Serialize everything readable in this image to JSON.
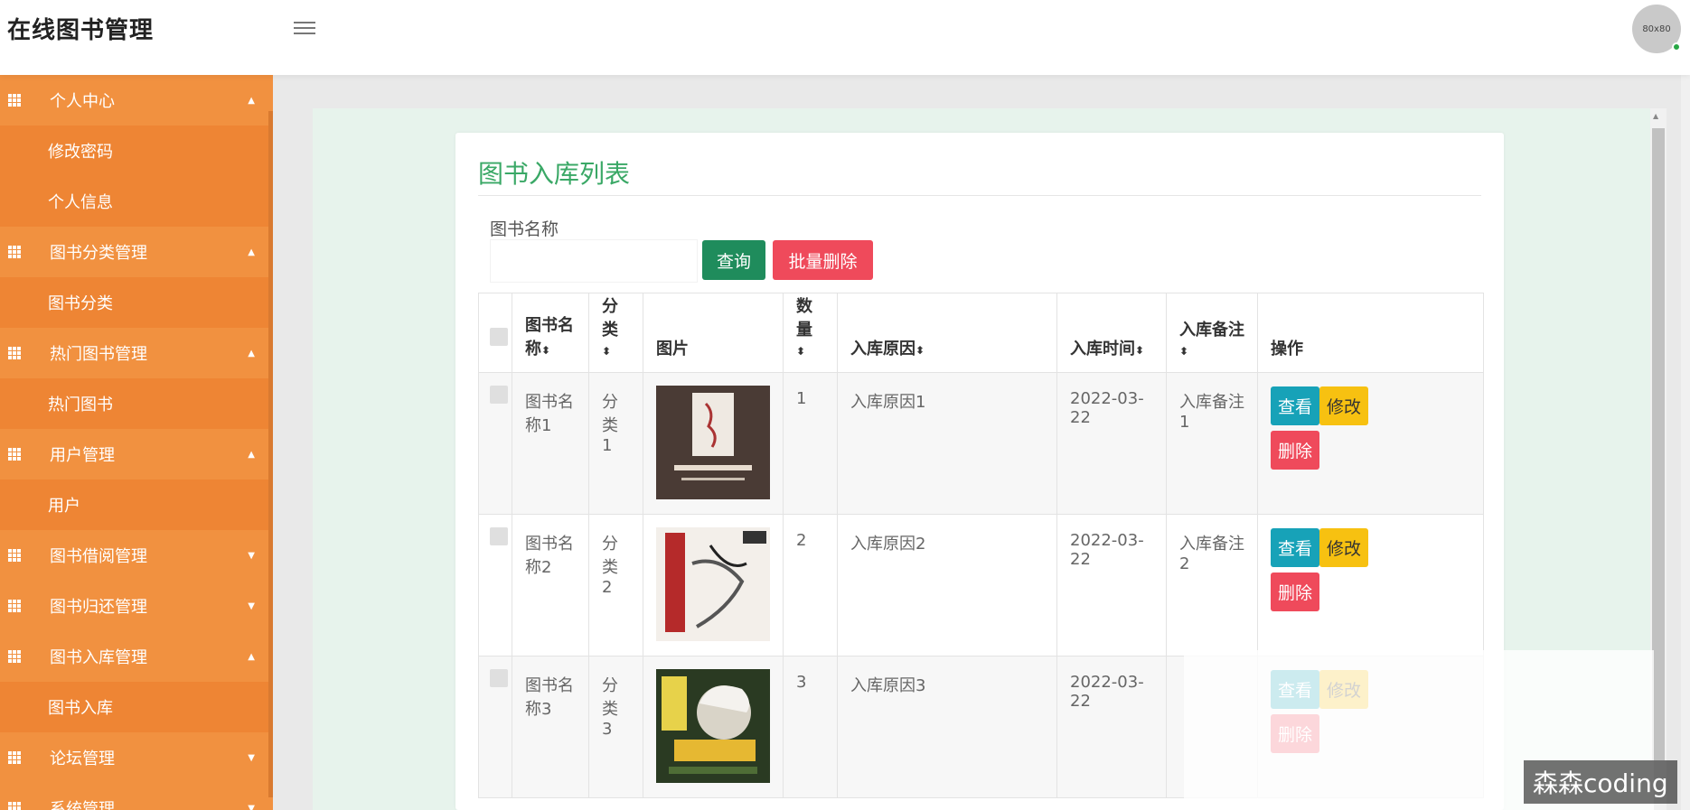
{
  "app": {
    "title": "在线图书管理",
    "avatar_text": "80x80"
  },
  "sidebar": {
    "sections": [
      {
        "label": "个人中心",
        "caret": "▲",
        "items": [
          "修改密码",
          "个人信息"
        ]
      },
      {
        "label": "图书分类管理",
        "caret": "▲",
        "items": [
          "图书分类"
        ]
      },
      {
        "label": "热门图书管理",
        "caret": "▲",
        "items": [
          "热门图书"
        ]
      },
      {
        "label": "用户管理",
        "caret": "▲",
        "items": [
          "用户"
        ]
      },
      {
        "label": "图书借阅管理",
        "caret": "▼",
        "items": []
      },
      {
        "label": "图书归还管理",
        "caret": "▼",
        "items": []
      },
      {
        "label": "图书入库管理",
        "caret": "▲",
        "items": [
          "图书入库"
        ]
      },
      {
        "label": "论坛管理",
        "caret": "▼",
        "items": []
      },
      {
        "label": "系统管理",
        "caret": "▼",
        "items": []
      }
    ]
  },
  "main": {
    "title": "图书入库列表",
    "search": {
      "label": "图书名称",
      "value": ""
    },
    "buttons": {
      "query": "查询",
      "batch_delete": "批量删除"
    },
    "table": {
      "headers": {
        "name_1": "图书名",
        "name_2": "称",
        "category": "分类",
        "image": "图片",
        "quantity": "数量",
        "reason": "入库原因",
        "time": "入库时间",
        "remark": "入库备注",
        "ops": "操作",
        "sort_icon": "⬍"
      },
      "rows": [
        {
          "name_1": "图书名",
          "name_2": "称1",
          "cat_1": "分类",
          "cat_2": "1",
          "qty": "1",
          "reason": "入库原因1",
          "time_1": "2022-03-",
          "time_2": "22",
          "remark_1": "入库备注",
          "remark_2": "1",
          "image": "book-cover-1"
        },
        {
          "name_1": "图书名",
          "name_2": "称2",
          "cat_1": "分类",
          "cat_2": "2",
          "qty": "2",
          "reason": "入库原因2",
          "time_1": "2022-03-",
          "time_2": "22",
          "remark_1": "入库备注",
          "remark_2": "2",
          "image": "book-cover-2"
        },
        {
          "name_1": "图书名",
          "name_2": "称3",
          "cat_1": "分类",
          "cat_2": "3",
          "qty": "3",
          "reason": "入库原因3",
          "time_1": "2022-03-",
          "time_2": "22",
          "remark_1": "",
          "remark_2": "",
          "image": "book-cover-3"
        }
      ],
      "actions": {
        "view": "查看",
        "edit": "修改",
        "delete": "删除"
      }
    }
  },
  "watermark": "森森coding",
  "colors": {
    "sidebar": "#f08a3c",
    "accent_green": "#3aa866",
    "query": "#1f8c5c",
    "danger": "#ef4a5b",
    "view": "#17a2b8",
    "edit": "#f7c111"
  }
}
